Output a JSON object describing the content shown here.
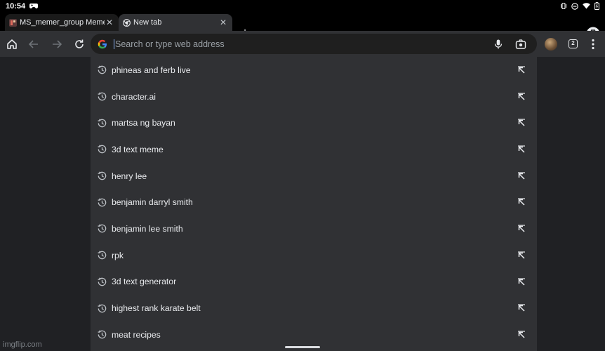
{
  "status_bar": {
    "time": "10:54",
    "left_icons": [
      "gamepad-icon"
    ],
    "right_icons": [
      "vibrate-icon",
      "dnd-icon",
      "wifi-icon",
      "battery-icon"
    ]
  },
  "tabs": [
    {
      "title": "MS_memer_group Meme",
      "favicon": "imgflip-favicon-icon",
      "active": false
    },
    {
      "title": "New tab",
      "favicon": "chrome-icon",
      "active": true
    }
  ],
  "tab_strip": {
    "new_tab_symbol": "+",
    "incognito_icon": "incognito-icon"
  },
  "toolbar": {
    "icons": [
      "home-icon",
      "back-arrow-icon",
      "forward-arrow-icon",
      "reload-icon"
    ],
    "omnibox_placeholder": "Search or type web address",
    "search_engine_icon": "google-g-icon",
    "tab_count": "2",
    "menu_icon": "more-vertical-icon"
  },
  "suggestions": [
    "phineas and ferb live",
    "character.ai",
    "martsa ng bayan",
    "3d text meme",
    "henry lee",
    "benjamin darryl smith",
    "benjamin lee smith",
    "rpk",
    "3d text generator",
    "highest rank karate belt",
    "meat recipes"
  ],
  "watermark": "imgflip.com",
  "colors": {
    "background": "#202124",
    "toolbar": "#303134",
    "omnibox": "#1f1f1f",
    "text": "#e8eaed",
    "muted_text": "#9aa0a6",
    "accent": "#8ab4f8"
  }
}
